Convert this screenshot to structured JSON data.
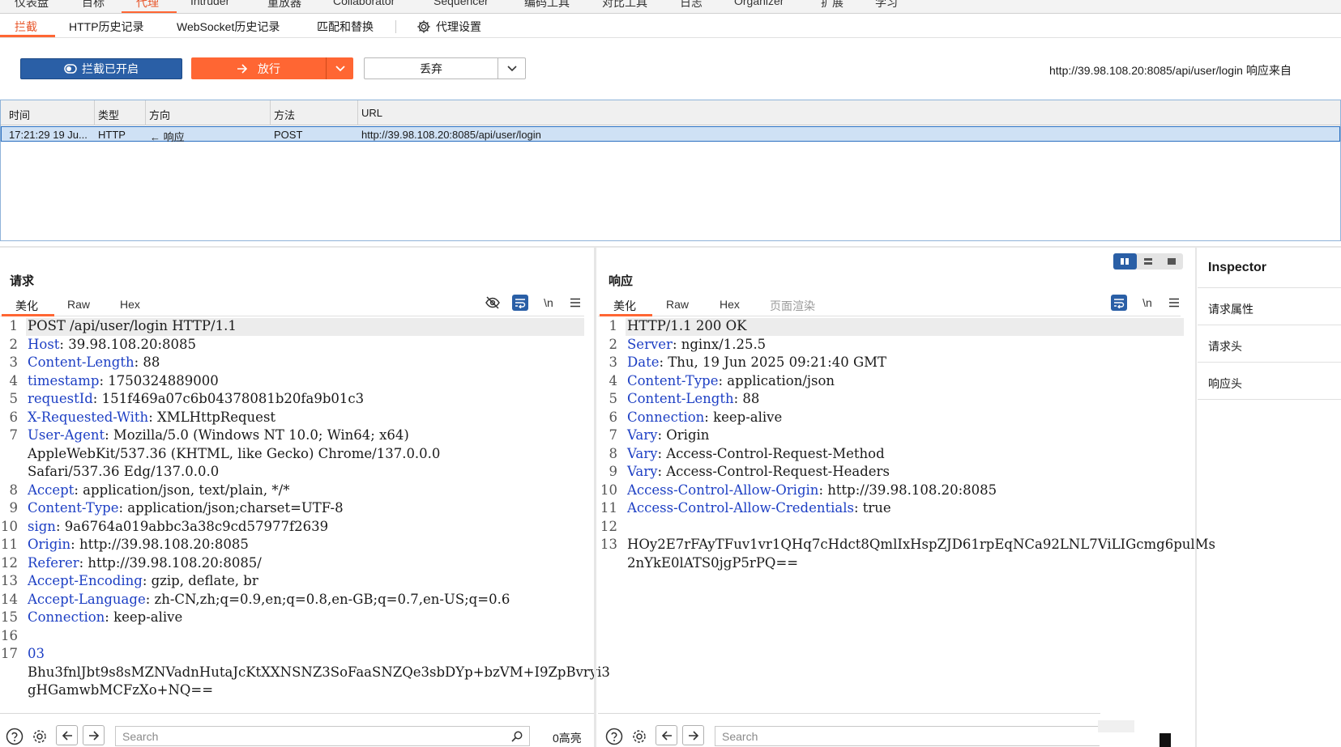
{
  "main_tabs": [
    "仪表盘",
    "目标",
    "代理",
    "Intruder",
    "重放器",
    "Collaborator",
    "Sequencer",
    "编码工具",
    "对比工具",
    "日志",
    "Organizer",
    "扩展",
    "学习"
  ],
  "sub_tabs": [
    "拦截",
    "HTTP历史记录",
    "WebSocket历史记录",
    "匹配和替换",
    "代理设置"
  ],
  "toolbar": {
    "intercept_label": "拦截已开启",
    "forward_label": "放行",
    "drop_label": "丢弃",
    "info": "http://39.98.108.20:8085/api/user/login 响应来自"
  },
  "history": {
    "columns": [
      "时间",
      "类型",
      "方向",
      "方法",
      "URL"
    ],
    "rows": [
      {
        "time": "17:21:29 19 Ju...",
        "type": "HTTP",
        "direction": "← 响应",
        "method": "POST",
        "url": "http://39.98.108.20:8085/api/user/login"
      }
    ]
  },
  "request": {
    "title": "请求",
    "tabs": [
      "美化",
      "Raw",
      "Hex"
    ],
    "lines": [
      {
        "n": "1",
        "k": "",
        "v": "POST /api/user/login HTTP/1.1"
      },
      {
        "n": "2",
        "k": "Host",
        "v": " 39.98.108.20:8085"
      },
      {
        "n": "3",
        "k": "Content-Length",
        "v": " 88"
      },
      {
        "n": "4",
        "k": "timestamp",
        "v": " 1750324889000"
      },
      {
        "n": "5",
        "k": "requestId",
        "v": " 151f469a07c6b04378081b20fa9b01c3"
      },
      {
        "n": "6",
        "k": "X-Requested-With",
        "v": " XMLHttpRequest"
      },
      {
        "n": "7",
        "k": "User-Agent",
        "v": " Mozilla/5.0 (Windows NT 10.0; Win64; x64)"
      },
      {
        "n": "",
        "k": "",
        "v": "AppleWebKit/537.36 (KHTML, like Gecko) Chrome/137.0.0.0"
      },
      {
        "n": "",
        "k": "",
        "v": "Safari/537.36 Edg/137.0.0.0"
      },
      {
        "n": "8",
        "k": "Accept",
        "v": " application/json, text/plain, */*"
      },
      {
        "n": "9",
        "k": "Content-Type",
        "v": " application/json;charset=UTF-8"
      },
      {
        "n": "10",
        "k": "sign",
        "v": " 9a6764a019abbc3a38c9cd57977f2639"
      },
      {
        "n": "11",
        "k": "Origin",
        "v": " http://39.98.108.20:8085"
      },
      {
        "n": "12",
        "k": "Referer",
        "v": " http://39.98.108.20:8085/"
      },
      {
        "n": "13",
        "k": "Accept-Encoding",
        "v": " gzip, deflate, br"
      },
      {
        "n": "14",
        "k": "Accept-Language",
        "v": " zh-CN,zh;q=0.9,en;q=0.8,en-GB;q=0.7,en-US;q=0.6"
      },
      {
        "n": "15",
        "k": "Connection",
        "v": " keep-alive"
      },
      {
        "n": "16",
        "k": "",
        "v": ""
      },
      {
        "n": "17",
        "k": "03",
        "v": ""
      },
      {
        "n": "",
        "k": "",
        "v": "Bhu3fnlJbt9s8sMZNVadnHutaJcKtXXNSNZ3SoFaaSNZQe3sbDYp+bzVM+I9ZpBvryi3"
      },
      {
        "n": "",
        "k": "",
        "v": "gHGamwbMCFzXo+NQ=="
      }
    ]
  },
  "response": {
    "title": "响应",
    "tabs": [
      "美化",
      "Raw",
      "Hex",
      "页面渲染"
    ],
    "lines": [
      {
        "n": "1",
        "k": "",
        "v": "HTTP/1.1 200 OK"
      },
      {
        "n": "2",
        "k": "Server",
        "v": " nginx/1.25.5"
      },
      {
        "n": "3",
        "k": "Date",
        "v": " Thu, 19 Jun 2025 09:21:40 GMT"
      },
      {
        "n": "4",
        "k": "Content-Type",
        "v": " application/json"
      },
      {
        "n": "5",
        "k": "Content-Length",
        "v": " 88"
      },
      {
        "n": "6",
        "k": "Connection",
        "v": " keep-alive"
      },
      {
        "n": "7",
        "k": "Vary",
        "v": " Origin"
      },
      {
        "n": "8",
        "k": "Vary",
        "v": " Access-Control-Request-Method"
      },
      {
        "n": "9",
        "k": "Vary",
        "v": " Access-Control-Request-Headers"
      },
      {
        "n": "10",
        "k": "Access-Control-Allow-Origin",
        "v": " http://39.98.108.20:8085"
      },
      {
        "n": "11",
        "k": "Access-Control-Allow-Credentials",
        "v": " true"
      },
      {
        "n": "12",
        "k": "",
        "v": ""
      },
      {
        "n": "13",
        "k": "",
        "v": "HOy2E7rFAyTFuv1vr1QHq7cHdct8QmlIxHspZJD61rpEqNCa92LNL7ViLIGcmg6pulMs"
      },
      {
        "n": "",
        "k": "",
        "v": "2nYkE0lATS0jgP5rPQ=="
      }
    ]
  },
  "search": {
    "placeholder": "Search"
  },
  "highlights": "0高亮",
  "inspector": {
    "title": "Inspector",
    "items": [
      "请求属性",
      "请求头",
      "响应头"
    ]
  }
}
